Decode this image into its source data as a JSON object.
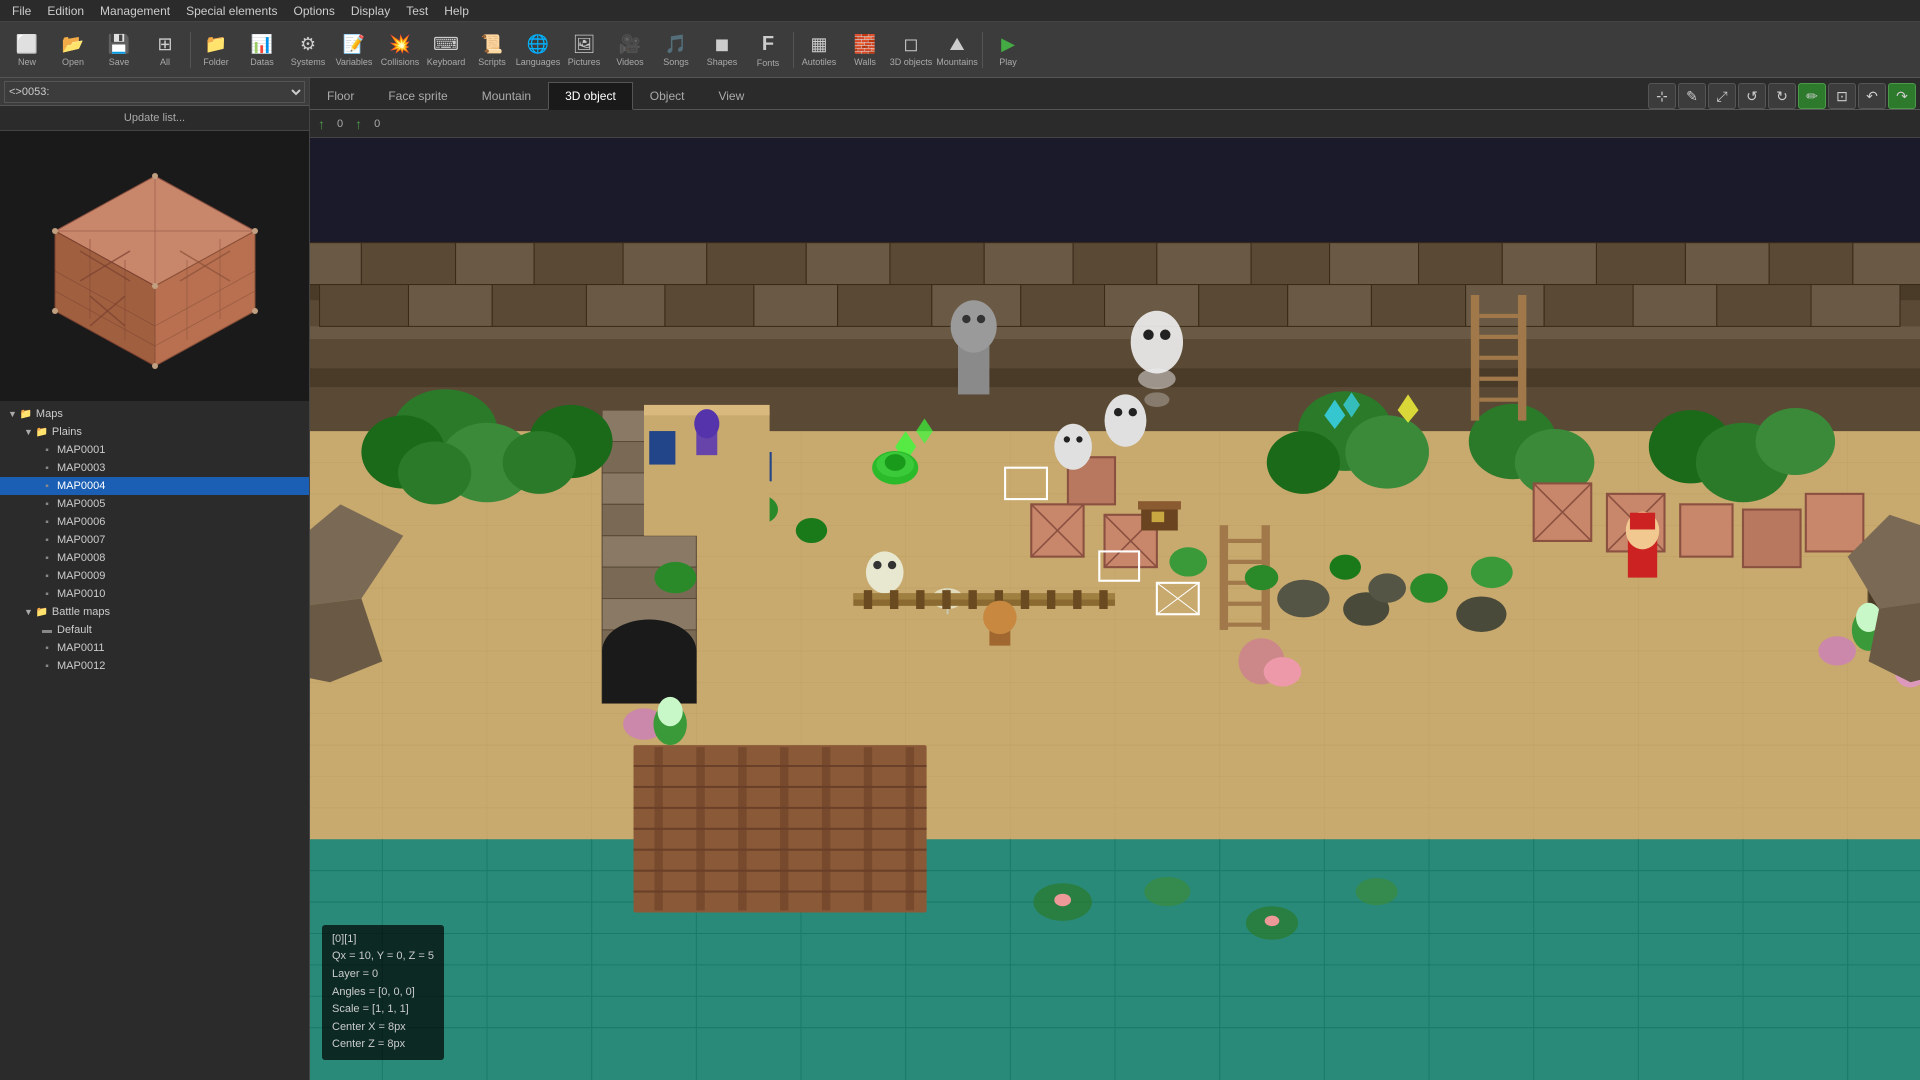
{
  "menubar": {
    "items": [
      "File",
      "Edition",
      "Management",
      "Special elements",
      "Options",
      "Display",
      "Test",
      "Help"
    ]
  },
  "toolbar": {
    "buttons": [
      {
        "id": "new",
        "icon": "🆕",
        "label": "New"
      },
      {
        "id": "open",
        "icon": "📂",
        "label": "Open"
      },
      {
        "id": "save",
        "icon": "💾",
        "label": "Save"
      },
      {
        "id": "all",
        "icon": "⊞",
        "label": "All"
      },
      {
        "id": "folder",
        "icon": "📁",
        "label": "Folder"
      },
      {
        "id": "datas",
        "icon": "📊",
        "label": "Datas"
      },
      {
        "id": "systems",
        "icon": "⚙",
        "label": "Systems"
      },
      {
        "id": "variables",
        "icon": "📝",
        "label": "Variables"
      },
      {
        "id": "collisions",
        "icon": "💥",
        "label": "Collisions"
      },
      {
        "id": "keyboard",
        "icon": "⌨",
        "label": "Keyboard"
      },
      {
        "id": "scripts",
        "icon": "📜",
        "label": "Scripts"
      },
      {
        "id": "languages",
        "icon": "🌐",
        "label": "Languages"
      },
      {
        "id": "pictures",
        "icon": "🖼",
        "label": "Pictures"
      },
      {
        "id": "videos",
        "icon": "🎥",
        "label": "Videos"
      },
      {
        "id": "songs",
        "icon": "🎵",
        "label": "Songs"
      },
      {
        "id": "shapes",
        "icon": "◼",
        "label": "Shapes"
      },
      {
        "id": "fonts",
        "icon": "F",
        "label": "Fonts"
      },
      {
        "id": "autotiles",
        "icon": "▦",
        "label": "Autotiles"
      },
      {
        "id": "walls",
        "icon": "🧱",
        "label": "Walls"
      },
      {
        "id": "3dobjects",
        "icon": "◻",
        "label": "3D objects"
      },
      {
        "id": "mountains",
        "icon": "⛰",
        "label": "Mountains"
      },
      {
        "id": "play",
        "icon": "▶",
        "label": "Play"
      }
    ]
  },
  "left_panel": {
    "map_selector": {
      "value": "<>0053:",
      "placeholder": "<>0053:"
    },
    "update_list_label": "Update list...",
    "tree": {
      "items": [
        {
          "id": "maps-root",
          "level": 1,
          "type": "folder",
          "label": "Maps",
          "expanded": true
        },
        {
          "id": "plains",
          "level": 2,
          "type": "folder",
          "label": "Plains",
          "expanded": true
        },
        {
          "id": "map0001",
          "level": 3,
          "type": "map",
          "label": "MAP0001"
        },
        {
          "id": "map0003",
          "level": 3,
          "type": "map",
          "label": "MAP0003"
        },
        {
          "id": "map0004",
          "level": 3,
          "type": "map",
          "label": "MAP0004",
          "selected": true
        },
        {
          "id": "map0005",
          "level": 3,
          "type": "map",
          "label": "MAP0005"
        },
        {
          "id": "map0006",
          "level": 3,
          "type": "map",
          "label": "MAP0006"
        },
        {
          "id": "map0007",
          "level": 3,
          "type": "map",
          "label": "MAP0007"
        },
        {
          "id": "map0008",
          "level": 3,
          "type": "map",
          "label": "MAP0008"
        },
        {
          "id": "map0009",
          "level": 3,
          "type": "map",
          "label": "MAP0009"
        },
        {
          "id": "map0010",
          "level": 3,
          "type": "map",
          "label": "MAP0010"
        },
        {
          "id": "battlemaps",
          "level": 2,
          "type": "folder",
          "label": "Battle maps",
          "expanded": true
        },
        {
          "id": "default",
          "level": 3,
          "type": "map-dash",
          "label": "Default"
        },
        {
          "id": "map0011",
          "level": 3,
          "type": "map",
          "label": "MAP0011"
        },
        {
          "id": "map0012",
          "level": 3,
          "type": "map",
          "label": "MAP0012"
        }
      ]
    }
  },
  "tabs": {
    "items": [
      "Floor",
      "Face sprite",
      "Mountain",
      "3D object",
      "Object",
      "View"
    ],
    "active": "3D object"
  },
  "view_tools": [
    {
      "id": "cursor",
      "icon": "⊹",
      "active": false
    },
    {
      "id": "pencil",
      "icon": "✎",
      "active": false
    },
    {
      "id": "arrows",
      "icon": "⤢",
      "active": false
    },
    {
      "id": "rotate-left",
      "icon": "↺",
      "active": false
    },
    {
      "id": "rotate-right",
      "icon": "↻",
      "active": false
    },
    {
      "id": "paint-green",
      "icon": "✏",
      "active": true,
      "color": "green"
    },
    {
      "id": "square",
      "icon": "⊡",
      "active": false
    },
    {
      "id": "undo",
      "icon": "↶",
      "active": false
    },
    {
      "id": "redo",
      "icon": "↷",
      "active": true,
      "color": "green"
    }
  ],
  "coords": {
    "x_label": "0",
    "y_label": "0"
  },
  "info_overlay": {
    "line1": "[0][1]",
    "line2": "Qx = 10, Y = 0, Z = 5",
    "line3": "Layer = 0",
    "line4": "Angles = [0, 0, 0]",
    "line5": "Scale = [1, 1, 1]",
    "line6": "Center X = 8px",
    "line7": "Center Z = 8px"
  },
  "colors": {
    "selected_bg": "#1a5fb4",
    "active_tab_bg": "#1a1a1a",
    "toolbar_bg": "#3c3c3c",
    "panel_bg": "#2b2b2b",
    "green_tool": "#2d7a2d",
    "folder_color": "#e8c060"
  }
}
